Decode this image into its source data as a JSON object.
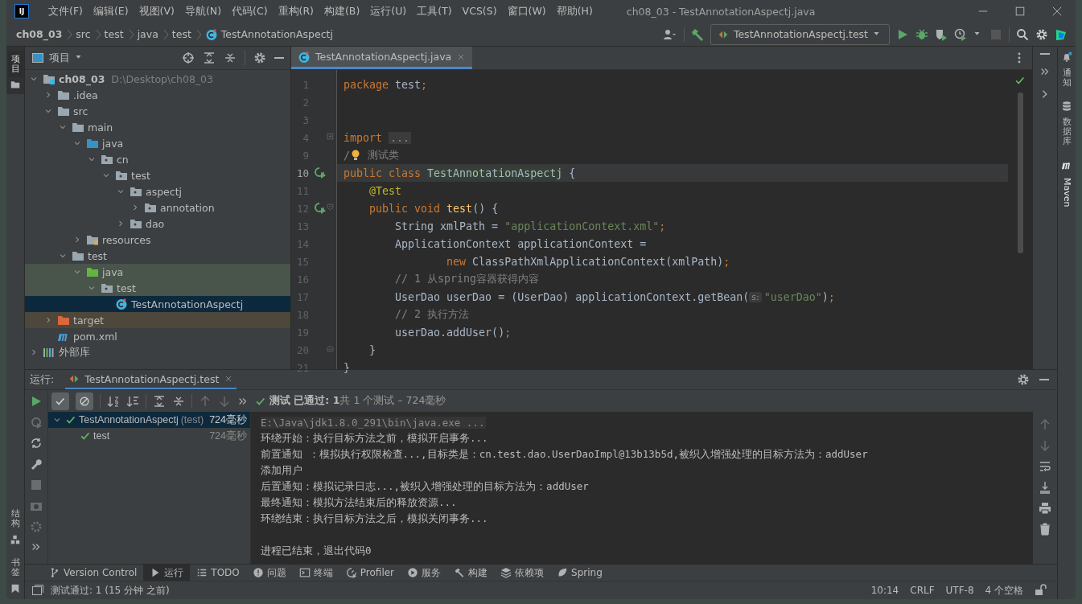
{
  "window": {
    "title": "ch08_03 - TestAnnotationAspectj.java",
    "logo": "IJ"
  },
  "menu": [
    "文件(F)",
    "编辑(E)",
    "视图(V)",
    "导航(N)",
    "代码(C)",
    "重构(R)",
    "构建(B)",
    "运行(U)",
    "工具(T)",
    "VCS(S)",
    "窗口(W)",
    "帮助(H)"
  ],
  "breadcrumb": [
    "ch08_03",
    "src",
    "test",
    "java",
    "test",
    "TestAnnotationAspectj"
  ],
  "toolbar": {
    "run_config": "TestAnnotationAspectj.test"
  },
  "left_strip": {
    "top": [
      {
        "label": "项目",
        "selected": true
      }
    ],
    "bottom": [
      {
        "label": "结构",
        "kind": "structure"
      },
      {
        "label": "书签",
        "kind": "bookmark"
      }
    ]
  },
  "right_strip": [
    {
      "label": "通知",
      "kind": "bell"
    },
    {
      "label": "数据库",
      "kind": "database"
    },
    {
      "label": "Maven",
      "kind": "maven"
    }
  ],
  "project": {
    "title": "项目",
    "tree": [
      {
        "label": "ch08_03",
        "hint": "D:\\Desktop\\ch08_03",
        "kind": "module",
        "expanded": true,
        "selected": false,
        "children": [
          {
            "label": ".idea",
            "kind": "folder",
            "expanded": false,
            "selected": false
          },
          {
            "label": "src",
            "kind": "folder",
            "expanded": true,
            "selected": false,
            "children": [
              {
                "label": "main",
                "kind": "folder",
                "expanded": true,
                "selected": false,
                "children": [
                  {
                    "label": "java",
                    "kind": "source",
                    "expanded": true,
                    "selected": false,
                    "children": [
                      {
                        "label": "cn",
                        "kind": "package",
                        "expanded": true,
                        "selected": false,
                        "children": [
                          {
                            "label": "test",
                            "kind": "package",
                            "expanded": true,
                            "selected": false,
                            "children": [
                              {
                                "label": "aspectj",
                                "kind": "package",
                                "expanded": true,
                                "selected": false,
                                "children": [
                                  {
                                    "label": "annotation",
                                    "kind": "package",
                                    "expanded": false,
                                    "selected": false
                                  }
                                ]
                              },
                              {
                                "label": "dao",
                                "kind": "package",
                                "expanded": false,
                                "selected": false
                              }
                            ]
                          }
                        ]
                      }
                    ]
                  },
                  {
                    "label": "resources",
                    "kind": "resources",
                    "expanded": false,
                    "selected": false
                  }
                ]
              },
              {
                "label": "test",
                "kind": "folder",
                "expanded": true,
                "selected": false,
                "children": [
                  {
                    "label": "java",
                    "kind": "test-source",
                    "expanded": true,
                    "test_scope": true,
                    "selected": false,
                    "children": [
                      {
                        "label": "test",
                        "kind": "package",
                        "expanded": true,
                        "test_scope": true,
                        "selected": false,
                        "children": [
                          {
                            "label": "TestAnnotationAspectj",
                            "kind": "class",
                            "selected": true
                          }
                        ]
                      }
                    ]
                  }
                ]
              }
            ]
          },
          {
            "label": "target",
            "kind": "excluded",
            "expanded": false,
            "excluded": true,
            "selected": false
          },
          {
            "label": "pom.xml",
            "kind": "maven",
            "selected": false
          }
        ]
      },
      {
        "label": "外部库",
        "kind": "library",
        "expanded": false,
        "selected": false
      }
    ]
  },
  "editor": {
    "tabs": [
      {
        "label": "TestAnnotationAspectj.java",
        "selected": true
      }
    ],
    "lines": [
      {
        "num": "1",
        "tokens": [
          {
            "kind": "kw",
            "text": "package "
          },
          {
            "kind": "plain",
            "text": "test"
          },
          {
            "kind": "kw",
            "text": ";"
          }
        ]
      },
      {
        "num": "2"
      },
      {
        "num": "3"
      },
      {
        "num": "4",
        "folded": true,
        "tokens": [
          {
            "kind": "kw",
            "text": "import "
          },
          {
            "kind": "folded",
            "text": "..."
          }
        ]
      },
      {
        "num": "9",
        "tokens": [
          {
            "kind": "comment",
            "text": "/"
          },
          {
            "kind": "bulb"
          },
          {
            "kind": "comment",
            "text": " 测试类"
          }
        ]
      },
      {
        "num": "10",
        "current": true,
        "runnable": true,
        "tokens": [
          {
            "kind": "kw",
            "text": "public class "
          },
          {
            "kind": "usage",
            "text": "TestAnnotationAspectj"
          },
          {
            "kind": "plain",
            "text": " {"
          }
        ]
      },
      {
        "num": "11",
        "tokens": [
          {
            "kind": "ann",
            "text": "    @Test"
          }
        ]
      },
      {
        "num": "12",
        "runnable": true,
        "fold_start": true,
        "tokens": [
          {
            "kind": "kw",
            "text": "    public void "
          },
          {
            "kind": "fn",
            "text": "test"
          },
          {
            "kind": "plain",
            "text": "() {"
          }
        ]
      },
      {
        "num": "13",
        "tokens": [
          {
            "kind": "plain",
            "text": "        String xmlPath = "
          },
          {
            "kind": "str",
            "text": "\"applicationContext.xml\""
          },
          {
            "kind": "kw",
            "text": ";"
          }
        ]
      },
      {
        "num": "14",
        "tokens": [
          {
            "kind": "plain",
            "text": "        ApplicationContext applicationContext ="
          }
        ]
      },
      {
        "num": "15",
        "tokens": [
          {
            "kind": "kw",
            "text": "                new "
          },
          {
            "kind": "plain",
            "text": "ClassPathXmlApplicationContext(xmlPath)"
          },
          {
            "kind": "kw",
            "text": ";"
          }
        ]
      },
      {
        "num": "16",
        "tokens": [
          {
            "kind": "comment",
            "text": "        // 1 从spring容器获得内容"
          }
        ]
      },
      {
        "num": "17",
        "tokens": [
          {
            "kind": "plain",
            "text": "        UserDao userDao = (UserDao) applicationContext.getBean("
          },
          {
            "kind": "hint",
            "text": "s:"
          },
          {
            "kind": "str",
            "text": "\"userDao\""
          },
          {
            "kind": "plain",
            "text": ")"
          },
          {
            "kind": "kw",
            "text": ";"
          }
        ]
      },
      {
        "num": "18",
        "tokens": [
          {
            "kind": "comment",
            "text": "        // 2 执行方法"
          }
        ]
      },
      {
        "num": "19",
        "tokens": [
          {
            "kind": "plain",
            "text": "        userDao.addUser()"
          },
          {
            "kind": "kw",
            "text": ";"
          }
        ]
      },
      {
        "num": "20",
        "fold_end": true,
        "tokens": [
          {
            "kind": "plain",
            "text": "    }"
          }
        ]
      },
      {
        "num": "21",
        "tokens": [
          {
            "kind": "plain",
            "text": "}"
          }
        ]
      }
    ]
  },
  "run": {
    "label": "运行:",
    "tab": "TestAnnotationAspectj.test",
    "summary": "**测试 已通过: 1**共 1 个测试 – 724毫秒",
    "toggles": [
      {
        "kind": "passed",
        "on": true
      },
      {
        "kind": "ignored",
        "on": true
      }
    ],
    "tree": [
      {
        "label": "TestAnnotationAspectj",
        "note": "(test)",
        "time": "724毫秒",
        "passed": true,
        "expanded": true,
        "selected": true,
        "children": [
          {
            "label": "test",
            "time": "724毫秒",
            "passed": true,
            "selected": false
          }
        ]
      }
    ],
    "console": [
      {
        "kind": "command",
        "text": "E:\\Java\\jdk1.8.0_291\\bin\\java.exe ..."
      },
      {
        "kind": "out",
        "text": "环绕开始：执行目标方法之前，模拟开启事务..."
      },
      {
        "kind": "out",
        "text": "前置通知 ：模拟执行权限检查...,目标类是：cn.test.dao.UserDaoImpl@13b13b5d,被织入增强处理的目标方法为：addUser"
      },
      {
        "kind": "out",
        "text": "添加用户"
      },
      {
        "kind": "out",
        "text": "后置通知：模拟记录日志...,被织入增强处理的目标方法为：addUser"
      },
      {
        "kind": "out",
        "text": "最终通知：模拟方法结束后的释放资源..."
      },
      {
        "kind": "out",
        "text": "环绕结束：执行目标方法之后，模拟关闭事务..."
      },
      {
        "kind": "blank"
      },
      {
        "kind": "out",
        "text": "进程已结束，退出代码0"
      }
    ]
  },
  "tool_tabs": [
    {
      "label": "Version Control",
      "kind": "vcs",
      "selected": false
    },
    {
      "label": "运行",
      "kind": "run",
      "selected": true
    },
    {
      "label": "TODO",
      "kind": "todo",
      "selected": false
    },
    {
      "label": "问题",
      "kind": "problems",
      "selected": false
    },
    {
      "label": "终端",
      "kind": "terminal",
      "selected": false
    },
    {
      "label": "Profiler",
      "kind": "profiler",
      "selected": false
    },
    {
      "label": "服务",
      "kind": "services",
      "selected": false
    },
    {
      "label": "构建",
      "kind": "build",
      "selected": false
    },
    {
      "label": "依赖项",
      "kind": "deps",
      "selected": false
    },
    {
      "label": "Spring",
      "kind": "spring",
      "selected": false
    }
  ],
  "status_bar": {
    "message": "测试通过: 1 (15 分钟 之前)",
    "items": [
      "10:14",
      "CRLF",
      "UTF-8",
      "4 个空格"
    ]
  }
}
